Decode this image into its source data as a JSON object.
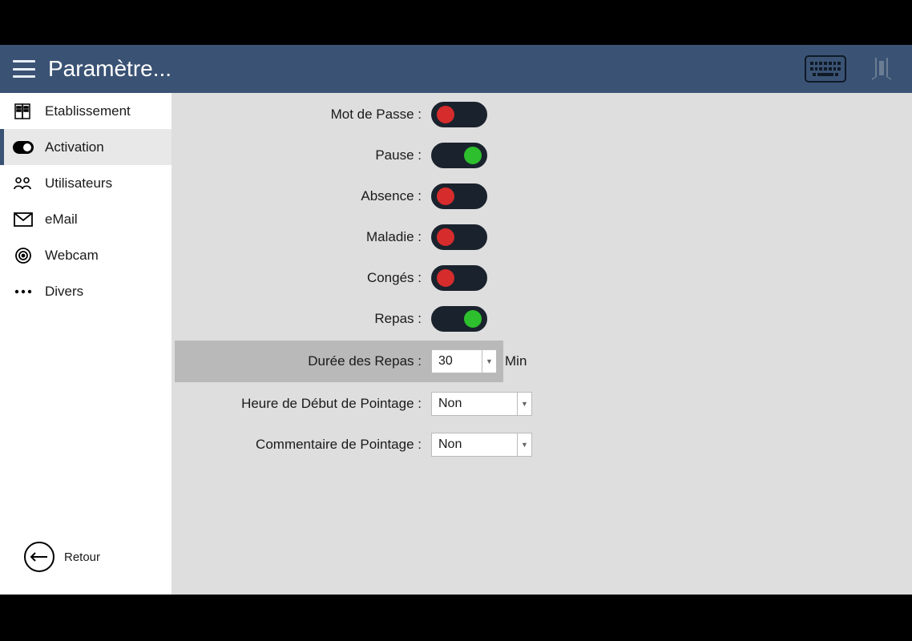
{
  "header": {
    "title": "Paramètre..."
  },
  "sidebar": {
    "items": [
      {
        "label": "Etablissement"
      },
      {
        "label": "Activation"
      },
      {
        "label": "Utilisateurs"
      },
      {
        "label": "eMail"
      },
      {
        "label": "Webcam"
      },
      {
        "label": "Divers"
      }
    ],
    "active_index": 1,
    "back_label": "Retour"
  },
  "main": {
    "toggles": [
      {
        "label": "Mot de Passe :",
        "state": "off"
      },
      {
        "label": "Pause :",
        "state": "on"
      },
      {
        "label": "Absence :",
        "state": "off"
      },
      {
        "label": "Maladie :",
        "state": "off"
      },
      {
        "label": "Congés :",
        "state": "off"
      },
      {
        "label": "Repas :",
        "state": "on"
      }
    ],
    "meal_duration": {
      "label": "Durée des Repas :",
      "value": "30",
      "unit": "Min"
    },
    "start_time": {
      "label": "Heure de Début de Pointage :",
      "value": "Non"
    },
    "comment": {
      "label": "Commentaire de Pointage :",
      "value": "Non"
    }
  }
}
